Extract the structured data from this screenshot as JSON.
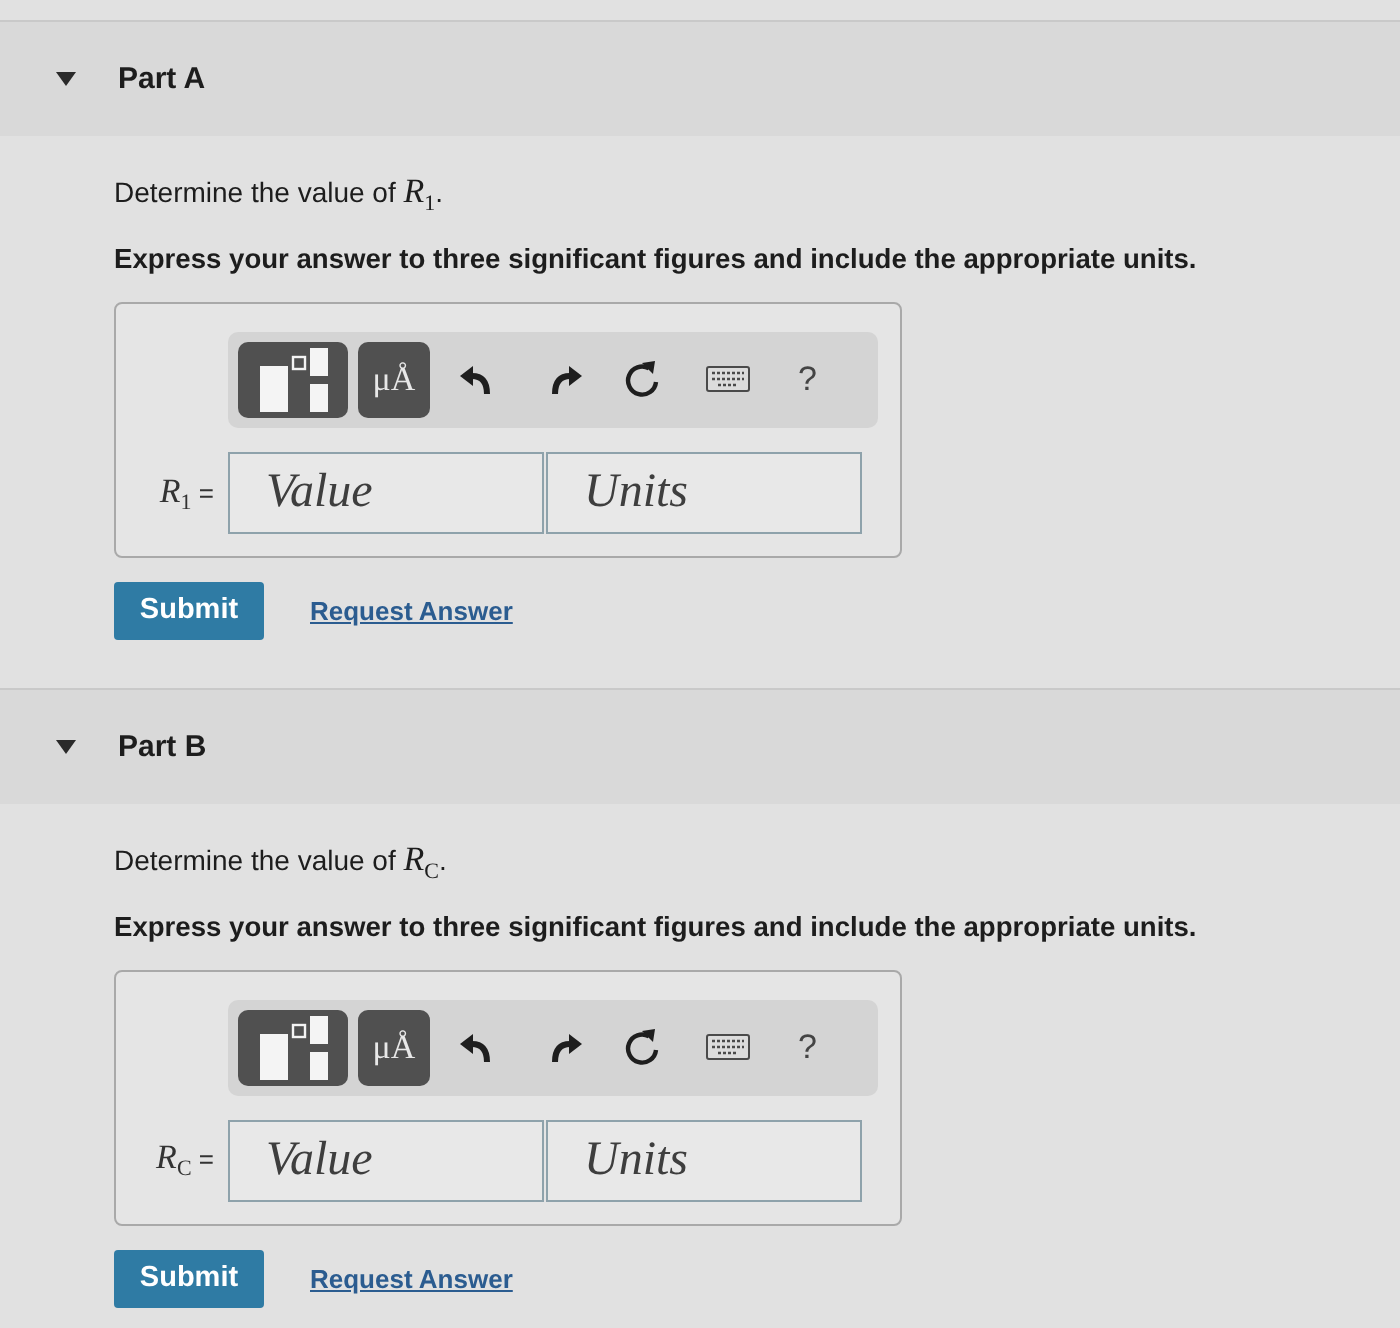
{
  "parts": [
    {
      "title": "Part A",
      "expanded": true,
      "prompt": "Determine the value of *R*$_{1}$.",
      "instruction": "Express your answer to three significant figures and include the appropriate units.",
      "answer": {
        "toolbar": [
          {
            "kind": "templates"
          },
          {
            "kind": "units",
            "label": "μÅ"
          },
          {
            "kind": "undo"
          },
          {
            "kind": "redo"
          },
          {
            "kind": "reset"
          },
          {
            "kind": "keyboard"
          },
          {
            "kind": "help",
            "label": "?"
          }
        ],
        "label": "*R*$_{1}$ =",
        "value": {
          "placeholder": "Value"
        },
        "units": {
          "placeholder": "Units"
        }
      },
      "submit": "Submit",
      "request": "Request Answer"
    },
    {
      "title": "Part B",
      "expanded": true,
      "prompt": "Determine the value of *R*$_{C}$.",
      "instruction": "Express your answer to three significant figures and include the appropriate units.",
      "answer": {
        "toolbar": [
          {
            "kind": "templates"
          },
          {
            "kind": "units",
            "label": "μÅ"
          },
          {
            "kind": "undo"
          },
          {
            "kind": "redo"
          },
          {
            "kind": "reset"
          },
          {
            "kind": "keyboard"
          },
          {
            "kind": "help",
            "label": "?"
          }
        ],
        "label": "*R*$_{C}$ =",
        "value": {
          "placeholder": "Value"
        },
        "units": {
          "placeholder": "Units"
        }
      },
      "submit": "Submit",
      "request": "Request Answer"
    }
  ]
}
